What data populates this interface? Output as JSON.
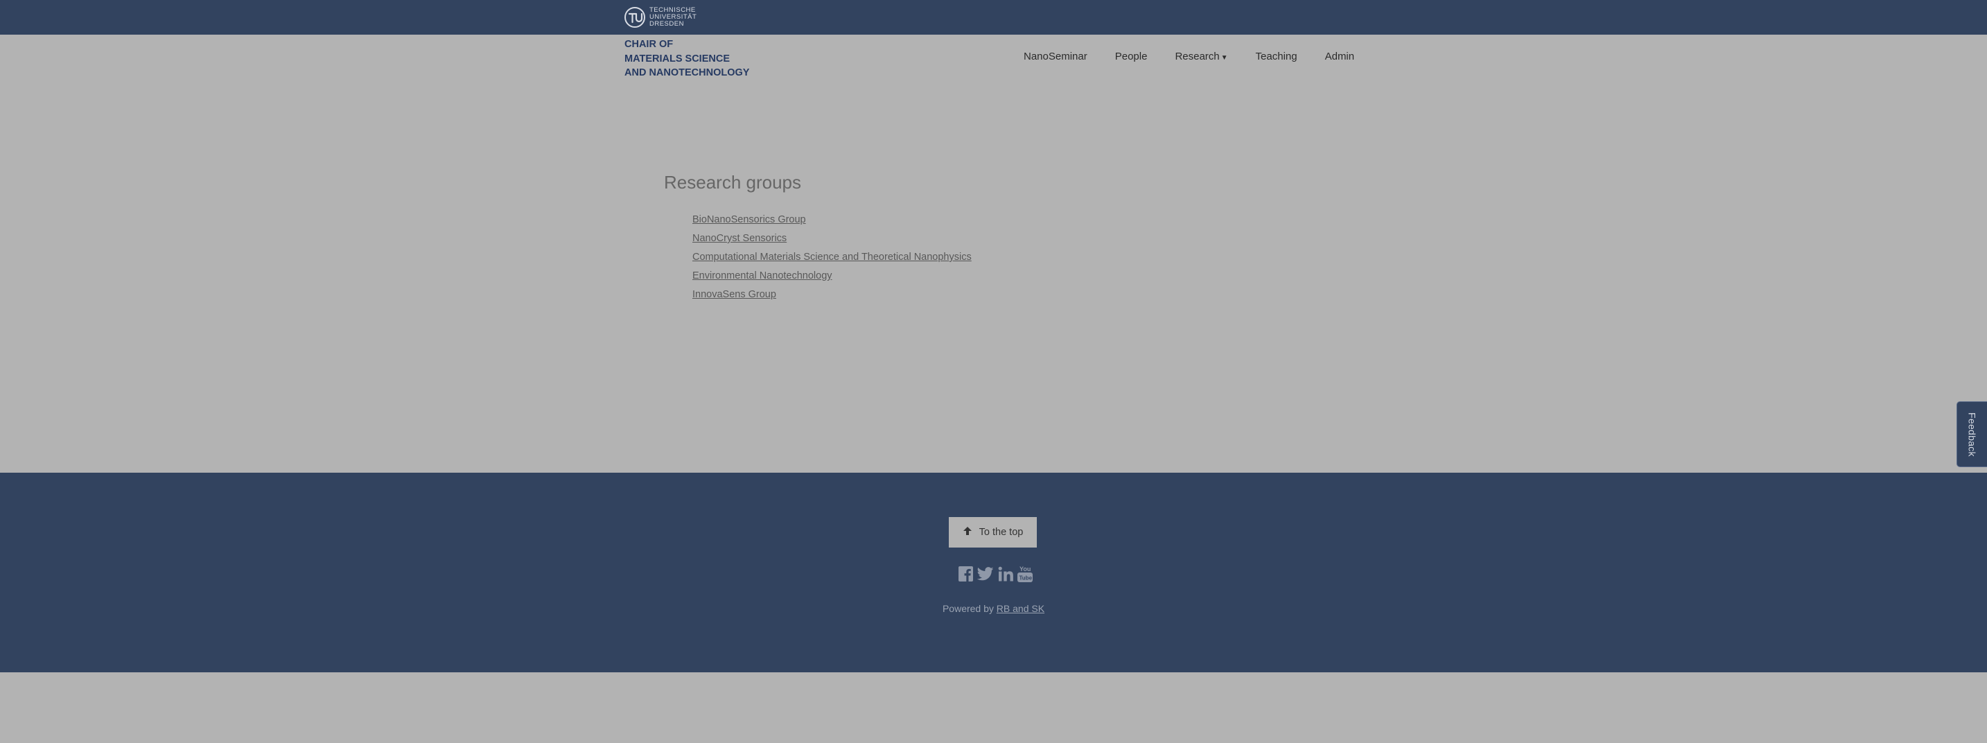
{
  "header": {
    "logo_words": [
      "TECHNISCHE",
      "UNIVERSITÄT",
      "DRESDEN"
    ],
    "chair_title_lines": [
      "CHAIR OF",
      "MATERIALS SCIENCE",
      "AND NANOTECHNOLOGY"
    ]
  },
  "nav": {
    "items": [
      {
        "label": "NanoSeminar"
      },
      {
        "label": "People"
      },
      {
        "label": "Research",
        "has_dropdown": true
      },
      {
        "label": "Teaching"
      },
      {
        "label": "Admin"
      }
    ]
  },
  "main": {
    "title": "Research groups",
    "groups": [
      "BioNanoSensorics Group",
      "NanoCryst Sensorics",
      "Computational Materials Science and Theoretical Nanophysics",
      "Environmental Nanotechnology",
      "InnovaSens Group"
    ]
  },
  "footer": {
    "to_top_label": "To the top",
    "social_icons": [
      "facebook-icon",
      "twitter-icon",
      "linkedin-icon",
      "youtube-icon"
    ],
    "powered_prefix": "Powered by",
    "powered_link": "RB and SK"
  },
  "feedback": {
    "label": "Feedback"
  },
  "colors": {
    "header_bg": "#32435f",
    "page_bg": "#b3b3b3",
    "title_text": "#263a62"
  }
}
